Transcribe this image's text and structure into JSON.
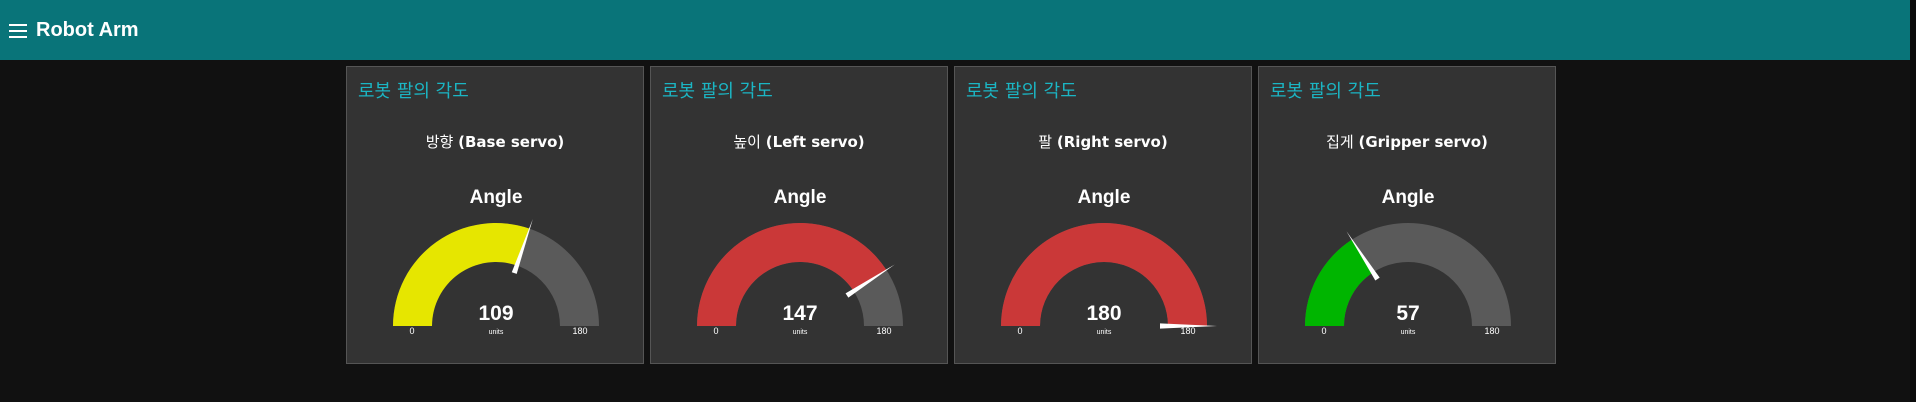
{
  "header": {
    "title": "Robot Arm",
    "menu_icon": "hamburger-menu-icon",
    "background_color": "#097479"
  },
  "gauges": [
    {
      "group_title": "로봇 팔의 각도",
      "label_ko": "방향",
      "label_en": "(Base servo)",
      "gauge_title": "Angle",
      "value": 109,
      "min": 0,
      "max": 180,
      "units": "units",
      "min_label": "0",
      "max_label": "180",
      "value_label": "109",
      "color": "#e6e600"
    },
    {
      "group_title": "로봇 팔의 각도",
      "label_ko": "높이",
      "label_en": "(Left servo)",
      "gauge_title": "Angle",
      "value": 147,
      "min": 0,
      "max": 180,
      "units": "units",
      "min_label": "0",
      "max_label": "180",
      "value_label": "147",
      "color": "#ca3838"
    },
    {
      "group_title": "로봇 팔의 각도",
      "label_ko": "팔",
      "label_en": "(Right servo)",
      "gauge_title": "Angle",
      "value": 180,
      "min": 0,
      "max": 180,
      "units": "units",
      "min_label": "0",
      "max_label": "180",
      "value_label": "180",
      "color": "#ca3838"
    },
    {
      "group_title": "로봇 팔의 각도",
      "label_ko": "집게",
      "label_en": "(Gripper servo)",
      "gauge_title": "Angle",
      "value": 57,
      "min": 0,
      "max": 180,
      "units": "units",
      "min_label": "0",
      "max_label": "180",
      "value_label": "57",
      "color": "#00b500"
    }
  ],
  "colors": {
    "page_background": "#111111",
    "card_background": "#333333",
    "group_title": "#1bb6c4",
    "gauge_track": "#5a5a5a",
    "needle": "#ffffff"
  }
}
